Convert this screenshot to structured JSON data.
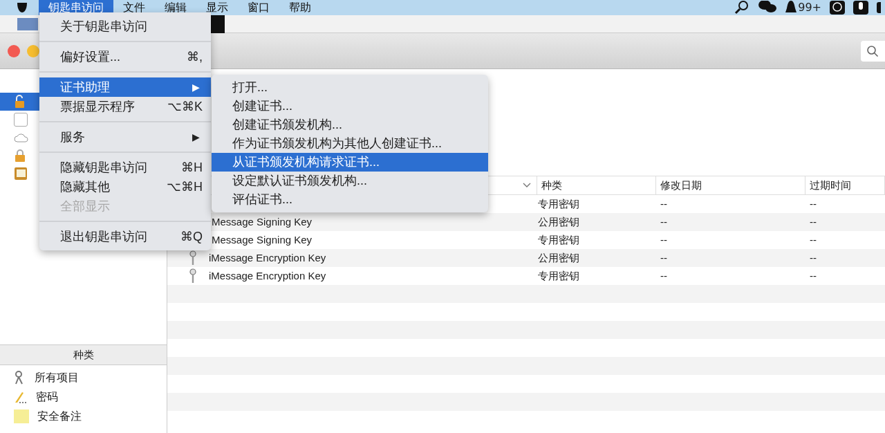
{
  "menu_bar": {
    "items": [
      {
        "label": "钥匙串访问",
        "selected": true
      },
      {
        "label": "文件",
        "selected": false
      },
      {
        "label": "编辑",
        "selected": false
      },
      {
        "label": "显示",
        "selected": false
      },
      {
        "label": "窗口",
        "selected": false
      },
      {
        "label": "帮助",
        "selected": false
      }
    ],
    "badge": "99+"
  },
  "app_menu": [
    {
      "kind": "item",
      "label": "关于钥匙串访问",
      "selected": false,
      "disabled": false
    },
    {
      "kind": "separator"
    },
    {
      "kind": "item",
      "label": "偏好设置...",
      "shortcut": "⌘,",
      "selected": false,
      "disabled": false
    },
    {
      "kind": "separator"
    },
    {
      "kind": "item",
      "label": "证书助理",
      "submenu": "▶",
      "selected": true,
      "disabled": false
    },
    {
      "kind": "item",
      "label": "票据显示程序",
      "shortcut": "⌥⌘K",
      "selected": false,
      "disabled": false
    },
    {
      "kind": "separator"
    },
    {
      "kind": "item",
      "label": "服务",
      "submenu": "▶",
      "selected": false,
      "disabled": false
    },
    {
      "kind": "separator"
    },
    {
      "kind": "item",
      "label": "隐藏钥匙串访问",
      "shortcut": "⌘H",
      "selected": false,
      "disabled": false
    },
    {
      "kind": "item",
      "label": "隐藏其他",
      "shortcut": "⌥⌘H",
      "selected": false,
      "disabled": false
    },
    {
      "kind": "item",
      "label": "全部显示",
      "selected": false,
      "disabled": true
    },
    {
      "kind": "separator"
    },
    {
      "kind": "item",
      "label": "退出钥匙串访问",
      "shortcut": "⌘Q",
      "selected": false,
      "disabled": false
    }
  ],
  "submenu": [
    {
      "label": "打开...",
      "selected": false
    },
    {
      "label": "创建证书...",
      "selected": false
    },
    {
      "label": "创建证书颁发机构...",
      "selected": false
    },
    {
      "label": "作为证书颁发机构为其他人创建证书...",
      "selected": false
    },
    {
      "label": "从证书颁发机构请求证书...",
      "selected": true
    },
    {
      "label": "设定默认证书颁发机构...",
      "selected": false
    },
    {
      "label": "评估证书...",
      "selected": false
    }
  ],
  "sidebar": {
    "keychains": [
      {
        "kind": "lock-open",
        "selected": true
      },
      {
        "kind": "blank",
        "selected": false
      },
      {
        "kind": "cloud",
        "selected": false
      },
      {
        "kind": "lock",
        "selected": false
      },
      {
        "kind": "cabinet",
        "selected": false
      }
    ],
    "category_header": "种类",
    "categories": [
      {
        "kind": "all",
        "label": "所有项目"
      },
      {
        "kind": "password",
        "label": "密码"
      },
      {
        "kind": "note",
        "label": "安全备注"
      }
    ]
  },
  "table": {
    "columns": [
      {
        "label": "种类"
      },
      {
        "label": "修改日期"
      },
      {
        "label": "过期时间"
      }
    ],
    "rows": [
      {
        "kind": "专用密钥",
        "modified": "--",
        "expires": "--"
      },
      {
        "name": "Message Signing Key",
        "kind": "公用密钥",
        "modified": "--",
        "expires": "--"
      },
      {
        "name": "Message Signing Key",
        "kind": "专用密钥",
        "modified": "--",
        "expires": "--"
      },
      {
        "name": "iMessage Encryption Key",
        "icon": true,
        "kind": "公用密钥",
        "modified": "--",
        "expires": "--"
      },
      {
        "name": "iMessage Encryption Key",
        "icon": true,
        "kind": "专用密钥",
        "modified": "--",
        "expires": "--"
      }
    ]
  }
}
